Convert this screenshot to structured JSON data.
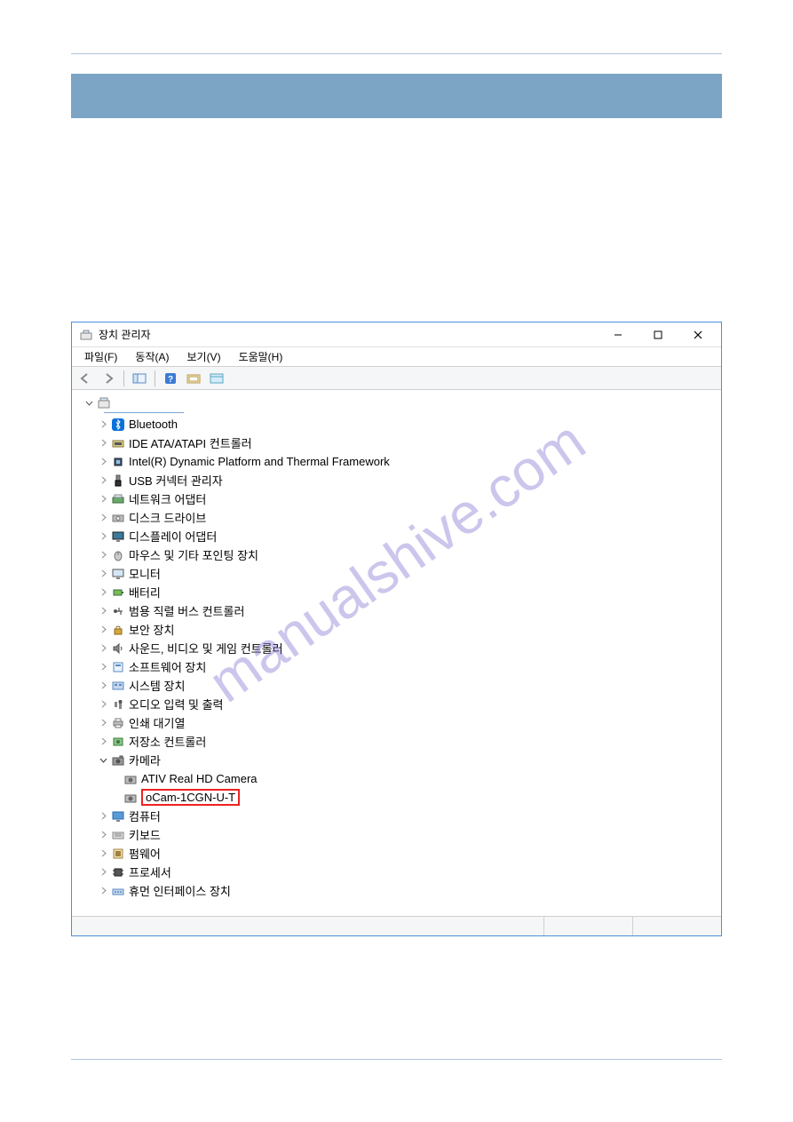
{
  "watermark": "manualshive.com",
  "window": {
    "title": "장치 관리자",
    "menus": {
      "file": "파일(F)",
      "action": "동작(A)",
      "view": "보기(V)",
      "help": "도움말(H)"
    }
  },
  "tree": {
    "root": "",
    "nodes": [
      {
        "label": "Bluetooth",
        "icon": "bluetooth",
        "expanded": false
      },
      {
        "label": "IDE ATA/ATAPI 컨트롤러",
        "icon": "ide",
        "expanded": false
      },
      {
        "label": "Intel(R) Dynamic Platform and Thermal Framework",
        "icon": "chip",
        "expanded": false
      },
      {
        "label": "USB 커넥터 관리자",
        "icon": "usb",
        "expanded": false
      },
      {
        "label": "네트워크 어댑터",
        "icon": "network",
        "expanded": false
      },
      {
        "label": "디스크 드라이브",
        "icon": "disk",
        "expanded": false
      },
      {
        "label": "디스플레이 어댑터",
        "icon": "display",
        "expanded": false
      },
      {
        "label": "마우스 및 기타 포인팅 장치",
        "icon": "mouse",
        "expanded": false
      },
      {
        "label": "모니터",
        "icon": "monitor",
        "expanded": false
      },
      {
        "label": "배터리",
        "icon": "battery",
        "expanded": false
      },
      {
        "label": "범용 직렬 버스 컨트롤러",
        "icon": "usbctrl",
        "expanded": false
      },
      {
        "label": "보안 장치",
        "icon": "security",
        "expanded": false
      },
      {
        "label": "사운드, 비디오 및 게임 컨트롤러",
        "icon": "sound",
        "expanded": false
      },
      {
        "label": "소프트웨어 장치",
        "icon": "software",
        "expanded": false
      },
      {
        "label": "시스템 장치",
        "icon": "system",
        "expanded": false
      },
      {
        "label": "오디오 입력 및 출력",
        "icon": "audio",
        "expanded": false
      },
      {
        "label": "인쇄 대기열",
        "icon": "printer",
        "expanded": false
      },
      {
        "label": "저장소 컨트롤러",
        "icon": "storage",
        "expanded": false
      },
      {
        "label": "카메라",
        "icon": "camera",
        "expanded": true,
        "children": [
          {
            "label": "ATIV Real HD Camera",
            "icon": "camera-dev",
            "highlight": false
          },
          {
            "label": "oCam-1CGN-U-T",
            "icon": "camera-dev",
            "highlight": true
          }
        ]
      },
      {
        "label": "컴퓨터",
        "icon": "computer",
        "expanded": false
      },
      {
        "label": "키보드",
        "icon": "keyboard",
        "expanded": false
      },
      {
        "label": "펌웨어",
        "icon": "firmware",
        "expanded": false
      },
      {
        "label": "프로세서",
        "icon": "processor",
        "expanded": false
      },
      {
        "label": "휴먼 인터페이스 장치",
        "icon": "hid",
        "expanded": false
      }
    ]
  }
}
